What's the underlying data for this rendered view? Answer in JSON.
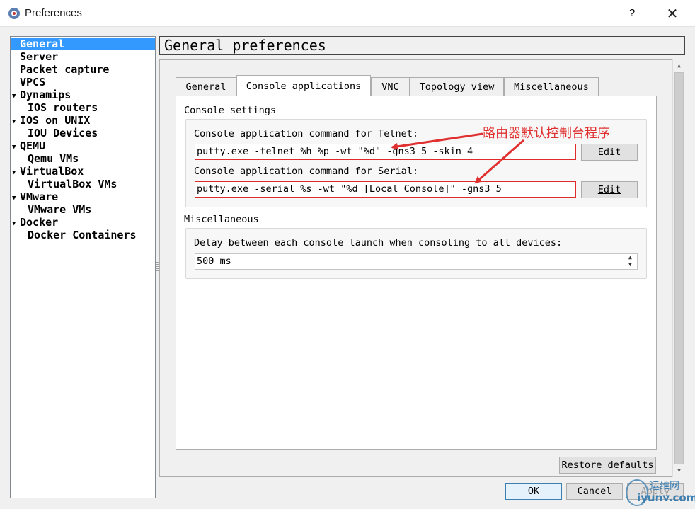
{
  "window": {
    "title": "Preferences",
    "help_label": "?",
    "close_label": "✕"
  },
  "sidebar": {
    "items": [
      {
        "label": "General",
        "selected": true,
        "expandable": false
      },
      {
        "label": "Server",
        "expandable": false
      },
      {
        "label": "Packet capture",
        "expandable": false
      },
      {
        "label": "VPCS",
        "expandable": false
      },
      {
        "label": "Dynamips",
        "expandable": true
      },
      {
        "label": "IOS routers",
        "child": true
      },
      {
        "label": "IOS on UNIX",
        "expandable": true
      },
      {
        "label": "IOU Devices",
        "child": true
      },
      {
        "label": "QEMU",
        "expandable": true
      },
      {
        "label": "Qemu VMs",
        "child": true
      },
      {
        "label": "VirtualBox",
        "expandable": true
      },
      {
        "label": "VirtualBox VMs",
        "child": true
      },
      {
        "label": "VMware",
        "expandable": true
      },
      {
        "label": "VMware VMs",
        "child": true
      },
      {
        "label": "Docker",
        "expandable": true
      },
      {
        "label": "Docker Containers",
        "child": true
      }
    ]
  },
  "header": {
    "title": "General preferences"
  },
  "tabs": [
    {
      "label": "General",
      "active": false
    },
    {
      "label": "Console applications",
      "active": true
    },
    {
      "label": "VNC",
      "active": false
    },
    {
      "label": "Topology view",
      "active": false
    },
    {
      "label": "Miscellaneous",
      "active": false
    }
  ],
  "console_settings": {
    "group_label": "Console settings",
    "telnet_label": "Console application command for Telnet:",
    "telnet_value": "putty.exe -telnet %h %p -wt \"%d\" -gns3 5 -skin 4",
    "serial_label": "Console application command for Serial:",
    "serial_value": "putty.exe -serial %s -wt \"%d [Local Console]\" -gns3 5",
    "edit_label": "Edit"
  },
  "miscellaneous": {
    "group_label": "Miscellaneous",
    "delay_label": "Delay between each console launch when consoling to all devices:",
    "delay_value": "500 ms"
  },
  "buttons": {
    "restore_defaults": "Restore defaults",
    "ok": "OK",
    "cancel": "Cancel",
    "apply": "Apply"
  },
  "annotation": {
    "text": "路由器默认控制台程序",
    "color": "#e03030"
  },
  "watermark": {
    "line1": "运维网",
    "line2": "iyunv.com"
  },
  "colors": {
    "selection": "#3399ff",
    "highlight_border": "#e02b2b"
  }
}
